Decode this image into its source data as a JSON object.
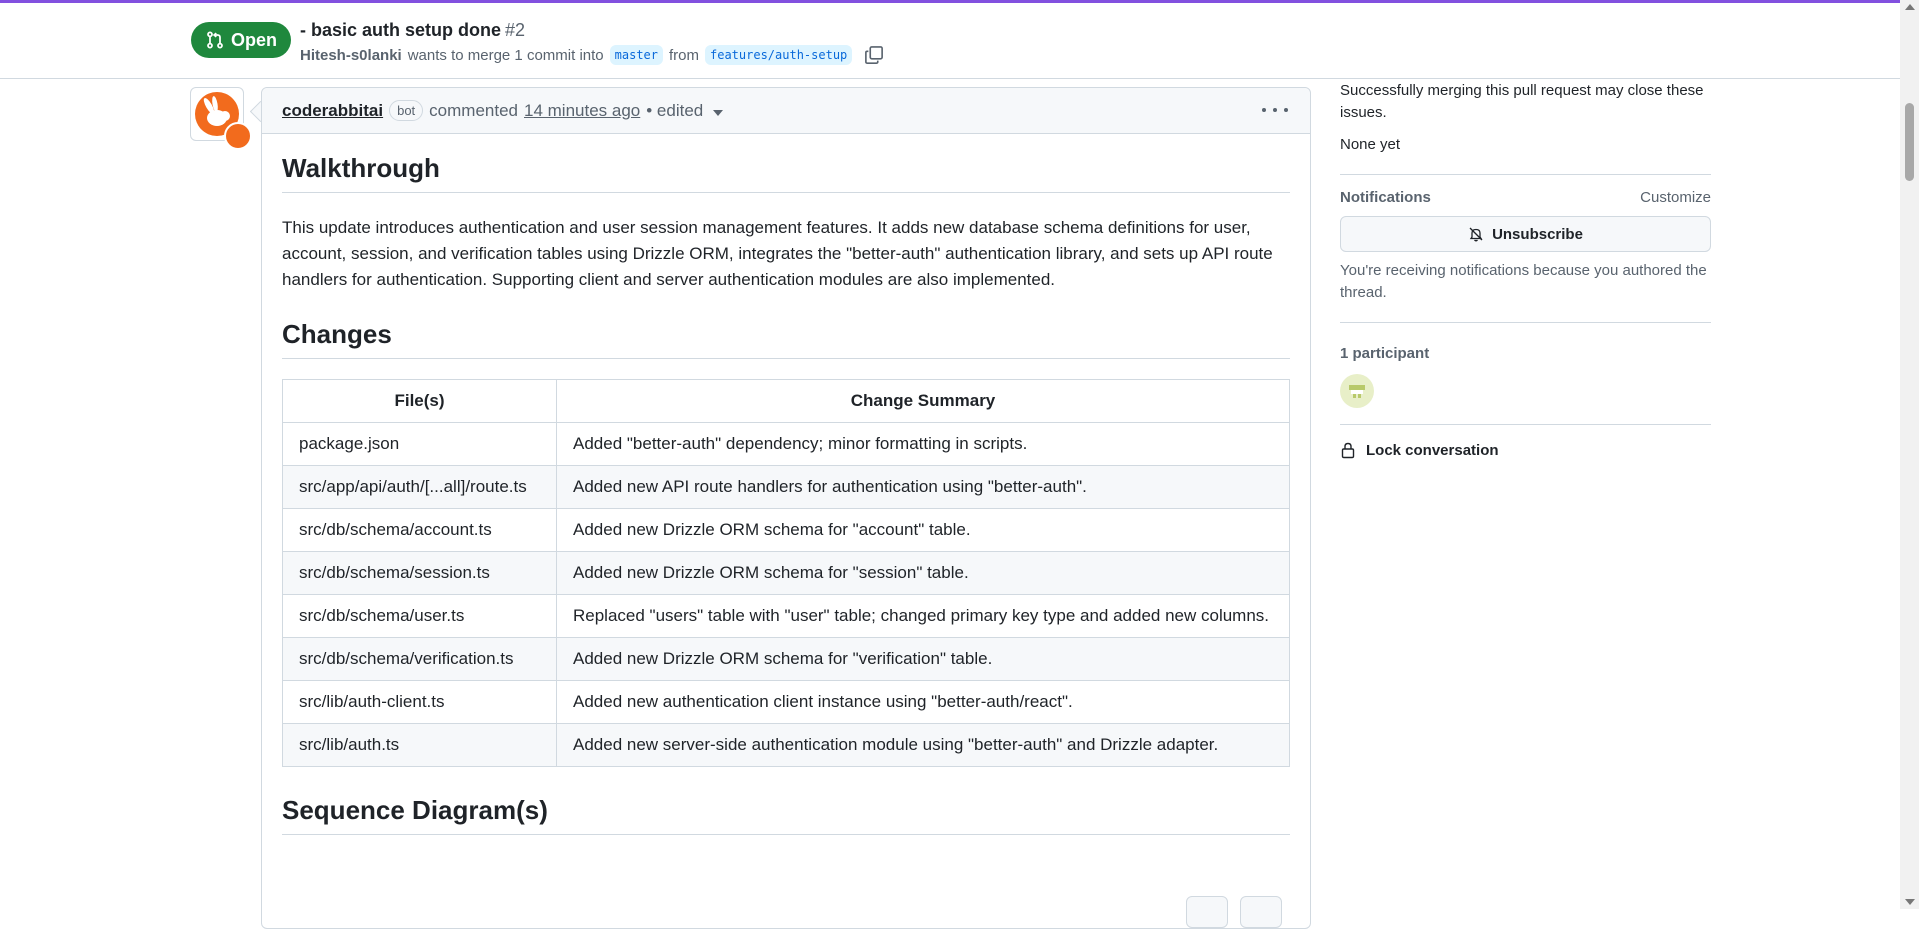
{
  "colors": {
    "accent_topline": "#8250df",
    "open_green": "#1f883d",
    "link_blue": "#0969da",
    "branch_bg": "#ddf4ff",
    "bot_orange": "#f26b1d"
  },
  "pr": {
    "state": "Open",
    "state_icon": "git-pull-request-icon",
    "title": "- basic auth setup done",
    "number": "#2",
    "author": "Hitesh-s0lanki",
    "merge_text": "wants to merge 1 commit into",
    "base_branch": "master",
    "from_text": "from",
    "head_branch": "features/auth-setup",
    "copy_icon": "copy-icon"
  },
  "comment": {
    "author": "coderabbitai",
    "badge": "bot",
    "action": "commented",
    "time": "14 minutes ago",
    "edited": "• edited",
    "walkthrough_heading": "Walkthrough",
    "walkthrough_text": "This update introduces authentication and user session management features. It adds new database schema definitions for user, account, session, and verification tables using Drizzle ORM, integrates the \"better-auth\" authentication library, and sets up API route handlers for authentication. Supporting client and server authentication modules are also implemented.",
    "changes_heading": "Changes",
    "table": {
      "headers": [
        "File(s)",
        "Change Summary"
      ],
      "rows": [
        {
          "file": "package.json",
          "summary": "Added \"better-auth\" dependency; minor formatting in scripts."
        },
        {
          "file": "src/app/api/auth/[...all]/route.ts",
          "summary": "Added new API route handlers for authentication using \"better-auth\"."
        },
        {
          "file": "src/db/schema/account.ts",
          "summary": "Added new Drizzle ORM schema for \"account\" table."
        },
        {
          "file": "src/db/schema/session.ts",
          "summary": "Added new Drizzle ORM schema for \"session\" table."
        },
        {
          "file": "src/db/schema/user.ts",
          "summary": "Replaced \"users\" table with \"user\" table; changed primary key type and added new columns."
        },
        {
          "file": "src/db/schema/verification.ts",
          "summary": "Added new Drizzle ORM schema for \"verification\" table."
        },
        {
          "file": "src/lib/auth-client.ts",
          "summary": "Added new authentication client instance using \"better-auth/react\"."
        },
        {
          "file": "src/lib/auth.ts",
          "summary": "Added new server-side authentication module using \"better-auth\" and Drizzle adapter."
        }
      ]
    },
    "sequence_heading": "Sequence Diagram(s)"
  },
  "sidebar": {
    "issues_text": "Successfully merging this pull request may close these issues.",
    "issues_value": "None yet",
    "notifications_title": "Notifications",
    "customize": "Customize",
    "unsubscribe": "Unsubscribe",
    "notif_reason": "You're receiving notifications because you authored the thread.",
    "participants_title": "1 participant",
    "lock": "Lock conversation"
  }
}
